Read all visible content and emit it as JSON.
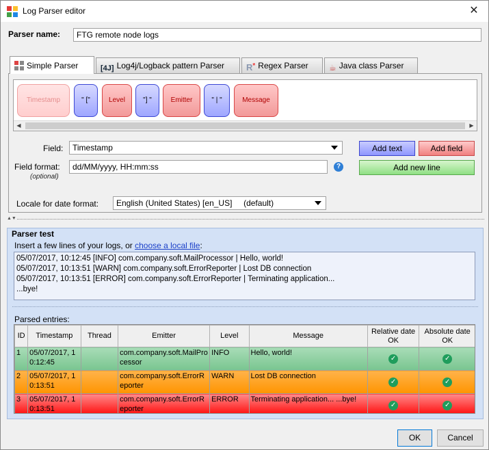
{
  "window": {
    "title": "Log Parser editor"
  },
  "parser": {
    "name_label": "Parser name:",
    "name_value": "FTG remote node logs"
  },
  "tabs": [
    {
      "label": "Simple Parser",
      "active": true
    },
    {
      "label": "Log4j/Logback pattern Parser",
      "active": false
    },
    {
      "label": "Regex Parser",
      "active": false
    },
    {
      "label": "Java class Parser",
      "active": false
    }
  ],
  "field_chips": [
    {
      "label": "Timestamp",
      "kind": "field",
      "selected": true
    },
    {
      "label": "\" [\"",
      "kind": "text"
    },
    {
      "label": "Level",
      "kind": "field"
    },
    {
      "label": "\"] \"",
      "kind": "text"
    },
    {
      "label": "Emitter",
      "kind": "field"
    },
    {
      "label": "\" | \"",
      "kind": "text"
    },
    {
      "label": "Message",
      "kind": "field"
    }
  ],
  "form": {
    "field_label": "Field:",
    "field_value": "Timestamp",
    "format_label": "Field format:",
    "format_optional": "(optional)",
    "format_value": "dd/MM/yyyy, HH:mm:ss",
    "locale_label": "Locale for date format:",
    "locale_value": "English (United States) [en_US]     (default)"
  },
  "buttons": {
    "add_text": "Add text",
    "add_field": "Add field",
    "add_new_line": "Add new line",
    "ok": "OK",
    "cancel": "Cancel"
  },
  "test": {
    "title": "Parser test",
    "instruction_prefix": "Insert a few lines of your logs, or ",
    "instruction_link": "choose a local file",
    "instruction_suffix": ":",
    "log_lines": [
      "05/07/2017, 10:12:45 [INFO] com.company.soft.MailProcessor | Hello, world!",
      "05/07/2017, 10:13:51 [WARN] com.company.soft.ErrorReporter | Lost DB connection",
      "05/07/2017, 10:13:51 [ERROR] com.company.soft.ErrorReporter | Terminating application...",
      "...bye!"
    ],
    "parsed_label": "Parsed entries:"
  },
  "table": {
    "columns": [
      "ID",
      "Timestamp",
      "Thread",
      "Emitter",
      "Level",
      "Message",
      "Relative date OK",
      "Absolute date OK"
    ],
    "rows": [
      {
        "id": "1",
        "timestamp": "05/07/2017, 10:12:45",
        "thread": "",
        "emitter": "com.company.soft.MailProcessor",
        "level": "INFO",
        "message": "Hello, world!",
        "relative_ok": true,
        "absolute_ok": true
      },
      {
        "id": "2",
        "timestamp": "05/07/2017, 10:13:51",
        "thread": "",
        "emitter": "com.company.soft.ErrorReporter",
        "level": "WARN",
        "message": "Lost DB connection",
        "relative_ok": true,
        "absolute_ok": true
      },
      {
        "id": "3",
        "timestamp": "05/07/2017, 10:13:51",
        "thread": "",
        "emitter": "com.company.soft.ErrorReporter",
        "level": "ERROR",
        "message": "Terminating application... ...bye!",
        "relative_ok": true,
        "absolute_ok": true
      }
    ]
  },
  "colors": {
    "info_row": "#79c58f",
    "warn_row": "#ff9400",
    "error_row": "#ff0000",
    "test_panel": "#d3e1f6"
  }
}
